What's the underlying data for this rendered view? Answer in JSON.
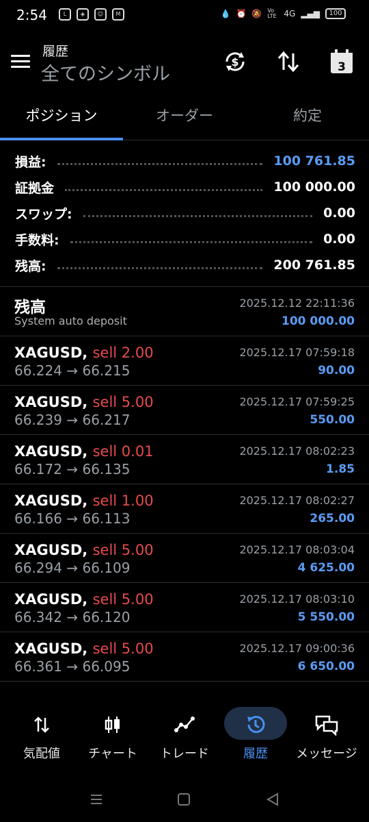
{
  "status_bar": {
    "time": "2:54",
    "left_icons": [
      "line-icon",
      "box-icon",
      "face-icon",
      "gmail-icon"
    ],
    "right_icons": [
      "water-drop-icon",
      "alarm-icon",
      "mute-icon",
      "volte-icon",
      "4g-signal-icon"
    ],
    "volte": "Vo LTE",
    "network": "4G",
    "battery": "100"
  },
  "header": {
    "title": "履歴",
    "subtitle": "全てのシンボル",
    "calendar_day": "3"
  },
  "tabs": [
    {
      "label": "ポジション",
      "active": true
    },
    {
      "label": "オーダー",
      "active": false
    },
    {
      "label": "約定",
      "active": false
    }
  ],
  "summary": [
    {
      "label": "損益:",
      "value": "100 761.85",
      "color": "#5a9cf5"
    },
    {
      "label": "証拠金",
      "value": "100 000.00",
      "color": "#ffffff"
    },
    {
      "label": "スワップ:",
      "value": "0.00",
      "color": "#ffffff"
    },
    {
      "label": "手数料:",
      "value": "0.00",
      "color": "#ffffff"
    },
    {
      "label": "残高:",
      "value": "200 761.85",
      "color": "#ffffff"
    }
  ],
  "deposit": {
    "title": "残高",
    "subtitle": "System auto deposit",
    "datetime": "2025.12.12 22:11:36",
    "amount": "100 000.00"
  },
  "trades": [
    {
      "symbol": "XAGUSD,",
      "side": "sell 2.00",
      "open": "66.224",
      "close": "66.215",
      "datetime": "2025.12.17 07:59:18",
      "profit": "90.00"
    },
    {
      "symbol": "XAGUSD,",
      "side": "sell 5.00",
      "open": "66.239",
      "close": "66.217",
      "datetime": "2025.12.17 07:59:25",
      "profit": "550.00"
    },
    {
      "symbol": "XAGUSD,",
      "side": "sell 0.01",
      "open": "66.172",
      "close": "66.135",
      "datetime": "2025.12.17 08:02:23",
      "profit": "1.85"
    },
    {
      "symbol": "XAGUSD,",
      "side": "sell 1.00",
      "open": "66.166",
      "close": "66.113",
      "datetime": "2025.12.17 08:02:27",
      "profit": "265.00"
    },
    {
      "symbol": "XAGUSD,",
      "side": "sell 5.00",
      "open": "66.294",
      "close": "66.109",
      "datetime": "2025.12.17 08:03:04",
      "profit": "4 625.00"
    },
    {
      "symbol": "XAGUSD,",
      "side": "sell 5.00",
      "open": "66.342",
      "close": "66.120",
      "datetime": "2025.12.17 08:03:10",
      "profit": "5 550.00"
    },
    {
      "symbol": "XAGUSD,",
      "side": "sell 5.00",
      "open": "66.361",
      "close": "66.095",
      "datetime": "2025.12.17 09:00:36",
      "profit": "6 650.00"
    }
  ],
  "arrow": "→",
  "bottom_nav": [
    {
      "label": "気配値",
      "icon": "quotes-icon",
      "active": false
    },
    {
      "label": "チャート",
      "icon": "chart-icon",
      "active": false
    },
    {
      "label": "トレード",
      "icon": "trade-icon",
      "active": false
    },
    {
      "label": "履歴",
      "icon": "history-icon",
      "active": true
    },
    {
      "label": "メッセージ",
      "icon": "messages-icon",
      "active": false
    }
  ],
  "colors": {
    "accent": "#4a8ff0",
    "profit_blue": "#5a9cf5",
    "sell_red": "#e84b4b",
    "background": "#000000"
  }
}
